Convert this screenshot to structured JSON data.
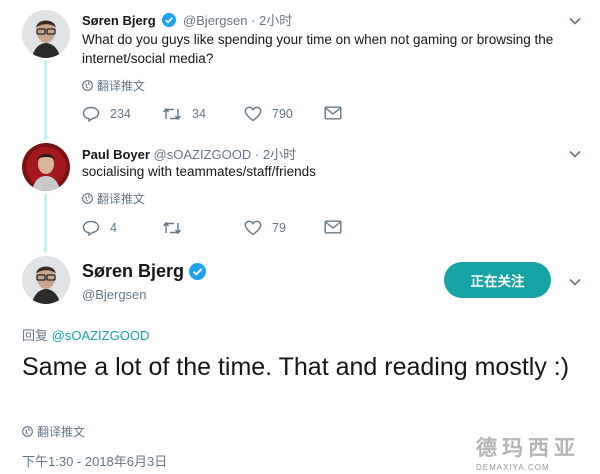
{
  "thread": [
    {
      "name": "Søren Bjerg",
      "handle": "@Bjergsen",
      "separator": "·",
      "time": "2小时",
      "text": "What do you guys like spending your time on when not gaming or browsing the internet/social media?",
      "translate": "翻译推文",
      "replies": "234",
      "retweets": "34",
      "likes": "790"
    },
    {
      "name": "Paul Boyer",
      "handle": "@sOAZIZGOOD",
      "separator": "·",
      "time": "2小时",
      "text": "socialising with teammates/staff/friends",
      "translate": "翻译推文",
      "replies": "4",
      "retweets": "",
      "likes": "79"
    }
  ],
  "main": {
    "name": "Søren Bjerg",
    "handle": "@Bjergsen",
    "follow_label": "正在关注",
    "reply_prefix": "回复",
    "reply_handle": "@sOAZIZGOOD",
    "text": "Same a lot of the time. That and reading mostly :)",
    "translate": "翻译推文",
    "timestamp": "下午1:30 - 2018年6月3日"
  },
  "watermark": {
    "top": "德玛西亚",
    "bottom": "DEMAXIYA.COM"
  },
  "colors": {
    "accent": "#17a2a4",
    "thread_line": "#c6f0ef",
    "muted": "#657786",
    "verified": "#1da1f2"
  }
}
